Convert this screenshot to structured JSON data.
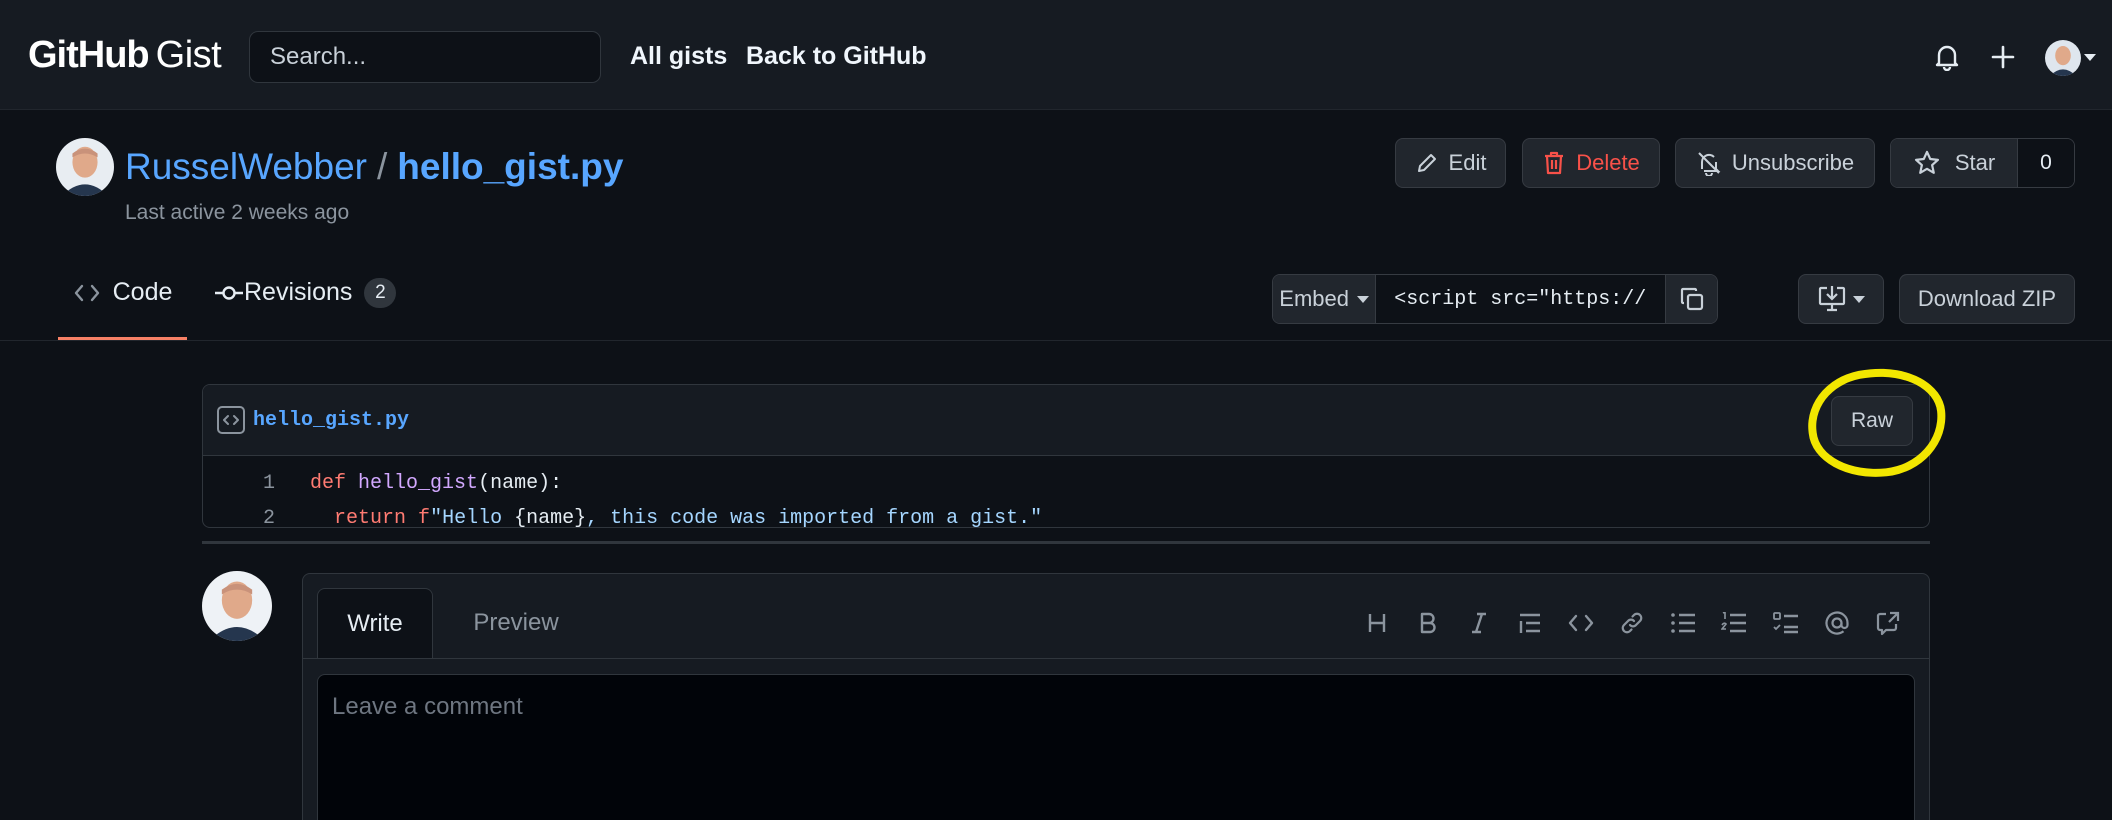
{
  "header": {
    "logo_main": "GitHub",
    "logo_sub": "Gist",
    "search_placeholder": "Search...",
    "nav": [
      "All gists",
      "Back to GitHub"
    ]
  },
  "gist": {
    "owner": "RusselWebber",
    "separator": "/",
    "filename": "hello_gist.py",
    "last_active": "Last active 2 weeks ago",
    "actions": {
      "edit": "Edit",
      "delete": "Delete",
      "unsubscribe": "Unsubscribe",
      "star": "Star",
      "star_count": "0"
    }
  },
  "tabs": {
    "code": "Code",
    "revisions": "Revisions",
    "revisions_count": "2"
  },
  "toolbar": {
    "embed": "Embed",
    "embed_value": "<script src=\"https://gis",
    "download_zip": "Download ZIP"
  },
  "file": {
    "name": "hello_gist.py",
    "raw": "Raw",
    "lines": [
      {
        "num": "1",
        "kw": "def",
        "fn": "hello_gist",
        "rest": "(name):"
      },
      {
        "num": "2",
        "kw": "return",
        "prefix": "f",
        "str": "\"Hello ",
        "interp": "{name}",
        "str2": ", this code was imported from a gist.\""
      }
    ]
  },
  "comment": {
    "write_tab": "Write",
    "preview_tab": "Preview",
    "placeholder": "Leave a comment",
    "toolbar_icons": [
      "heading-icon",
      "bold-icon",
      "italic-icon",
      "quote-icon",
      "code-icon",
      "link-icon",
      "unordered-list-icon",
      "ordered-list-icon",
      "task-list-icon",
      "mention-icon",
      "reference-icon"
    ]
  },
  "colors": {
    "background": "#0d1117",
    "header_bg": "#161b22",
    "link": "#58a6ff",
    "danger": "#f85149",
    "active_tab": "#f78166",
    "highlight": "#f2e700"
  }
}
